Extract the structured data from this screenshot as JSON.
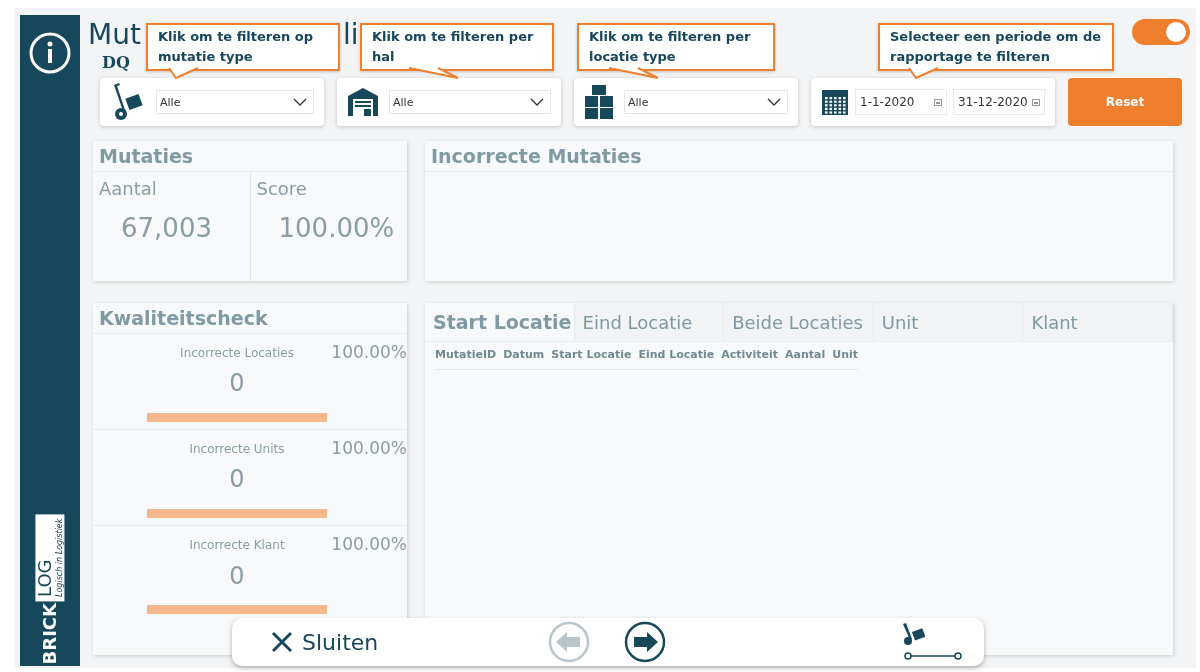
{
  "page": {
    "title_parts": [
      "Mut",
      "li"
    ],
    "subtitle": "DQ",
    "filters_on": true
  },
  "callouts": [
    {
      "text": "Klik om te filteren op mutatie type"
    },
    {
      "text": "Klik om te filteren per hal"
    },
    {
      "text": "Klik om te filteren per locatie type"
    },
    {
      "text": "Selecteer een periode om de rapportage te filteren"
    }
  ],
  "filters": [
    {
      "kind": "dropdown",
      "value": "Alle"
    },
    {
      "kind": "dropdown",
      "value": "Alle"
    },
    {
      "kind": "dropdown",
      "value": "Alle"
    },
    {
      "kind": "daterange",
      "from": "1-1-2020",
      "to": "31-12-2020"
    }
  ],
  "reset_button": "Reset",
  "mutaties": {
    "title": "Mutaties",
    "stats": [
      {
        "label": "Aantal",
        "value": "67,003"
      },
      {
        "label": "Score",
        "value": "100.00%"
      }
    ]
  },
  "incorrecte_mutaties": {
    "title": "Incorrecte Mutaties"
  },
  "kwaliteitscheck": {
    "title": "Kwaliteitscheck",
    "items": [
      {
        "label": "Incorrecte Locaties",
        "percent": "100.00%",
        "count": "0"
      },
      {
        "label": "Incorrecte Units",
        "percent": "100.00%",
        "count": "0"
      },
      {
        "label": "Incorrecte Klant",
        "percent": "100.00%",
        "count": "0"
      }
    ]
  },
  "tabs": [
    {
      "label": "Start Locatie",
      "selected": true
    },
    {
      "label": "Eind Locatie",
      "selected": false
    },
    {
      "label": "Beide Locaties",
      "selected": false
    },
    {
      "label": "Unit",
      "selected": false
    },
    {
      "label": "Klant",
      "selected": false
    }
  ],
  "table": {
    "columns": [
      "MutatieID",
      "Datum",
      "Start Locatie",
      "Eind Locatie",
      "Activiteit",
      "Aantal",
      "Unit"
    ]
  },
  "logo": {
    "brick": "BRICK",
    "log": "LOG",
    "tagline": "Logisch in Logistiek"
  },
  "bottom_bar": {
    "close_label": "Sluiten",
    "back_disabled": true,
    "next_disabled": false
  }
}
